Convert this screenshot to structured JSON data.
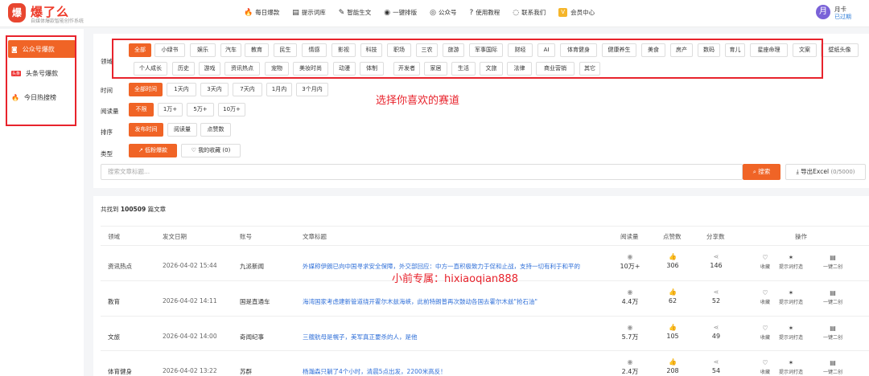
{
  "app": {
    "logo_char": "爆",
    "name": "爆了么",
    "tagline": "自媒体爆款智能创作系统"
  },
  "nav": [
    {
      "icon": "🔥",
      "label": "每日爆款"
    },
    {
      "icon": "▤",
      "label": "提示词库"
    },
    {
      "icon": "✎",
      "label": "智能生文"
    },
    {
      "icon": "◉",
      "label": "一键排版"
    },
    {
      "icon": "◎",
      "label": "公众号"
    },
    {
      "icon": "?",
      "label": "使用教程"
    },
    {
      "icon": "◌",
      "label": "联系我们"
    },
    {
      "icon": "V",
      "label": "会员中心"
    }
  ],
  "user": {
    "avatar": "月",
    "name": "月卡",
    "status": "已过期"
  },
  "sidebar": [
    {
      "label": "公众号爆款",
      "badge": "",
      "active": true
    },
    {
      "label": "头条号爆款",
      "badge": "头条",
      "active": false
    },
    {
      "label": "今日热搜榜",
      "badge": "",
      "active": false
    }
  ],
  "filters": {
    "domain_label": "领域",
    "domain_row1": [
      "全部",
      "小绿书",
      "娱乐",
      "汽车",
      "教育",
      "民生",
      "情感",
      "影视",
      "科技",
      "职场",
      "三农",
      "旅游",
      "军事国际",
      "财经",
      "AI",
      "体育健身",
      "健康养生",
      "美食",
      "房产",
      "数码",
      "育儿",
      "星座命理",
      "文案",
      "壁纸头像"
    ],
    "domain_row2": [
      "个人成长",
      "历史",
      "游戏",
      "资讯热点",
      "宠物",
      "美妆时尚",
      "动漫",
      "体制",
      "开发者",
      "家居",
      "生活",
      "文旅",
      "法律",
      "商业营销",
      "其它"
    ],
    "time_label": "时间",
    "time": [
      "全部时间",
      "1天内",
      "3天内",
      "7天内",
      "1月内",
      "3个月内"
    ],
    "reads_label": "阅读量",
    "reads": [
      "不限",
      "1万+",
      "5万+",
      "10万+"
    ],
    "sort_label": "排序",
    "sort": [
      "发布时间",
      "阅读量",
      "点赞数"
    ],
    "type_label": "类型",
    "type": [
      "低粉爆款",
      "我的收藏 (0)"
    ]
  },
  "annotation": "选择你喜欢的赛道",
  "search": {
    "placeholder": "搜索文章标题...",
    "button": "搜索",
    "export": "导出Excel",
    "export_count": "(0/5000)"
  },
  "results": {
    "prefix": "共找到",
    "count": "100509",
    "suffix": "篇文章"
  },
  "table": {
    "headers": [
      "领域",
      "发文日期",
      "账号",
      "文章标题",
      "阅读量",
      "点赞数",
      "分享数",
      "操作"
    ],
    "actions": [
      "收藏",
      "提示词打造",
      "一键二创"
    ],
    "rows": [
      {
        "domain": "资讯热点",
        "date": "2026-04-02 15:44",
        "account": "九派新闻",
        "title": "外媒称伊朗已向中国寻求安全保障，外交部回应：中方一直积极致力于促和止战，支持一切有利于和平的",
        "reads": "10万+",
        "likes": "306",
        "shares": "146"
      },
      {
        "domain": "教育",
        "date": "2026-04-02 14:11",
        "account": "国是直通车",
        "title": "海湾国家考虑建新管道绕开霍尔木兹海峡，此前特朗普再次鼓动各国去霍尔木兹\"抢石油\"",
        "reads": "4.4万",
        "likes": "62",
        "shares": "52"
      },
      {
        "domain": "文旅",
        "date": "2026-04-02 14:00",
        "account": "奇闻纪事",
        "title": "三艘航母是幌子，美军真正要杀的人，是他",
        "reads": "5.7万",
        "likes": "105",
        "shares": "49"
      },
      {
        "domain": "体育健身",
        "date": "2026-04-02 13:22",
        "account": "苏群",
        "title": "杨瀚森只躺了4个小时，清晨5点出发，2200米高反！",
        "reads": "2.4万",
        "likes": "208",
        "shares": "54"
      }
    ]
  },
  "watermark": "小前专属：hixiaoqian888"
}
